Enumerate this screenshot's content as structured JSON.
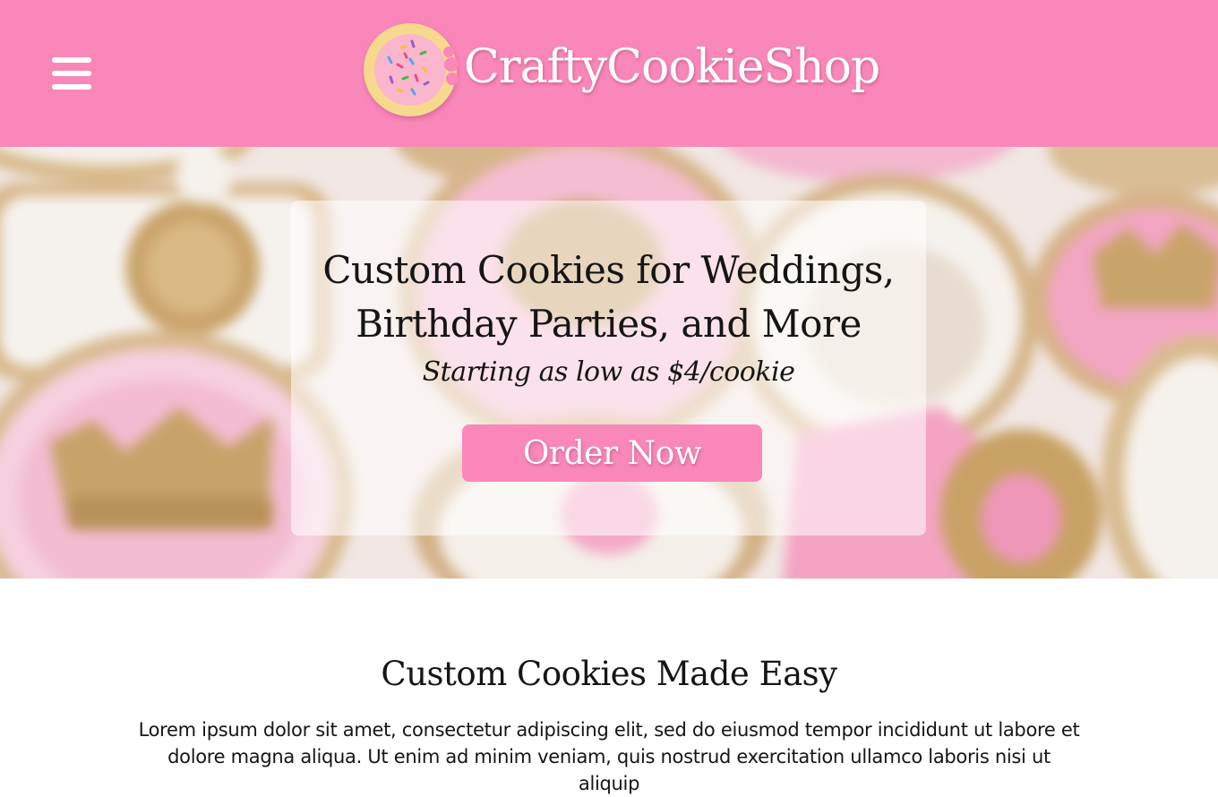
{
  "header": {
    "brand_name": "CraftyCookieShop",
    "background_color": "#fa87ba",
    "menu_icon": "hamburger-menu-icon",
    "logo_icon": "sprinkle-cookie-logo"
  },
  "hero": {
    "title_line1": "Custom Cookies for Weddings,",
    "title_line2": "Birthday Parties, and More",
    "subtitle": "Starting as low as $4/cookie",
    "cta_label": "Order Now",
    "cta_color": "#fa87ba"
  },
  "section": {
    "title": "Custom Cookies Made Easy",
    "body": "Lorem ipsum dolor sit amet, consectetur adipiscing elit, sed do eiusmod tempor incididunt ut labore et dolore magna aliqua. Ut enim ad minim veniam, quis nostrud exercitation ullamco laboris nisi ut aliquip"
  }
}
